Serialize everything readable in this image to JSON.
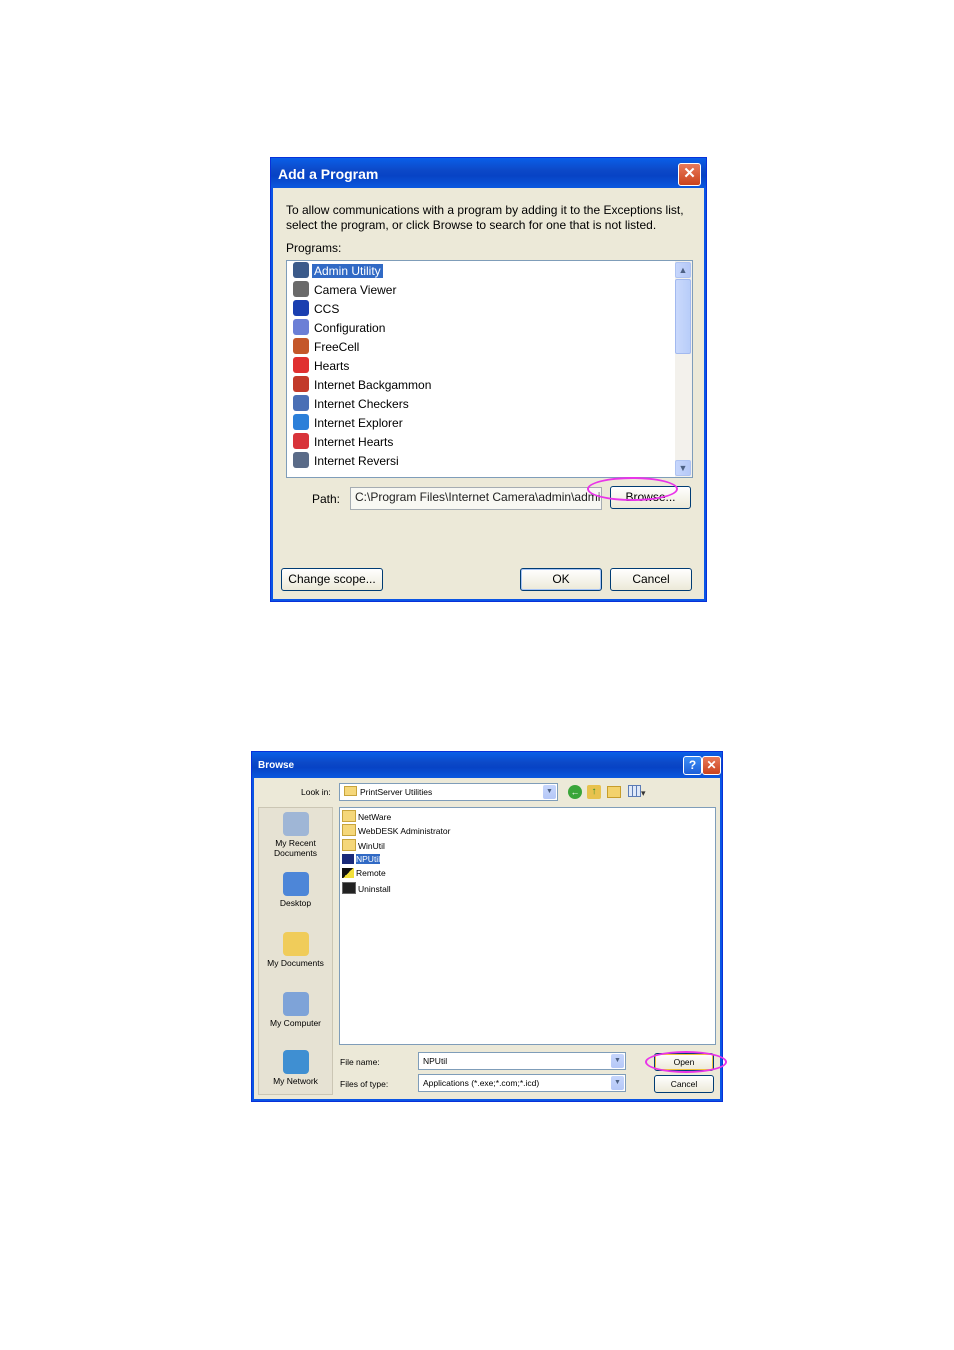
{
  "add_program": {
    "title": "Add a Program",
    "description": "To allow communications with a program by adding it to the Exceptions list, select the program, or click Browse to search for one that is not listed.",
    "programs_label": "Programs:",
    "programs": [
      {
        "name": "Admin Utility",
        "icon": "admin-utility-icon",
        "selected": true
      },
      {
        "name": "Camera Viewer",
        "icon": "camera-viewer-icon",
        "selected": false
      },
      {
        "name": "CCS",
        "icon": "ccs-icon",
        "selected": false
      },
      {
        "name": "Configuration",
        "icon": "configuration-icon",
        "selected": false
      },
      {
        "name": "FreeCell",
        "icon": "freecell-icon",
        "selected": false
      },
      {
        "name": "Hearts",
        "icon": "hearts-icon",
        "selected": false
      },
      {
        "name": "Internet Backgammon",
        "icon": "backgammon-icon",
        "selected": false
      },
      {
        "name": "Internet Checkers",
        "icon": "checkers-icon",
        "selected": false
      },
      {
        "name": "Internet Explorer",
        "icon": "internet-explorer-icon",
        "selected": false
      },
      {
        "name": "Internet Hearts",
        "icon": "internet-hearts-icon",
        "selected": false
      },
      {
        "name": "Internet Reversi",
        "icon": "reversi-icon",
        "selected": false
      }
    ],
    "path_label": "Path:",
    "path_value": "C:\\Program Files\\Internet Camera\\admin\\admi",
    "browse_label": "Browse...",
    "change_scope_label": "Change scope...",
    "ok_label": "OK",
    "cancel_label": "Cancel"
  },
  "browse": {
    "title": "Browse",
    "look_in_label": "Look in:",
    "look_in_value": "PrintServer Utilities",
    "places": [
      {
        "label": "My Recent Documents",
        "icon": "recent-documents-icon"
      },
      {
        "label": "Desktop",
        "icon": "desktop-icon"
      },
      {
        "label": "My Documents",
        "icon": "my-documents-icon"
      },
      {
        "label": "My Computer",
        "icon": "my-computer-icon"
      },
      {
        "label": "My Network",
        "icon": "my-network-icon"
      }
    ],
    "files": [
      {
        "name": "NetWare",
        "icon": "folder-icon",
        "selected": false
      },
      {
        "name": "WebDESK Administrator",
        "icon": "folder-icon",
        "selected": false
      },
      {
        "name": "WinUtil",
        "icon": "folder-icon",
        "selected": false
      },
      {
        "name": "NPUtil",
        "icon": "npautil-app-icon",
        "selected": true
      },
      {
        "name": "Remote",
        "icon": "remote-app-icon",
        "selected": false
      },
      {
        "name": "Uninstall",
        "icon": "uninstall-app-icon",
        "selected": false
      }
    ],
    "file_name_label": "File name:",
    "file_name_value": "NPUtil",
    "file_type_label": "Files of type:",
    "file_type_value": "Applications (*.exe;*.com;*.icd)",
    "open_label": "Open",
    "cancel_label": "Cancel"
  },
  "colors": {
    "titlebar": "#0a58df",
    "selection": "#316ac5",
    "highlight_ellipse": "#e934e9"
  }
}
